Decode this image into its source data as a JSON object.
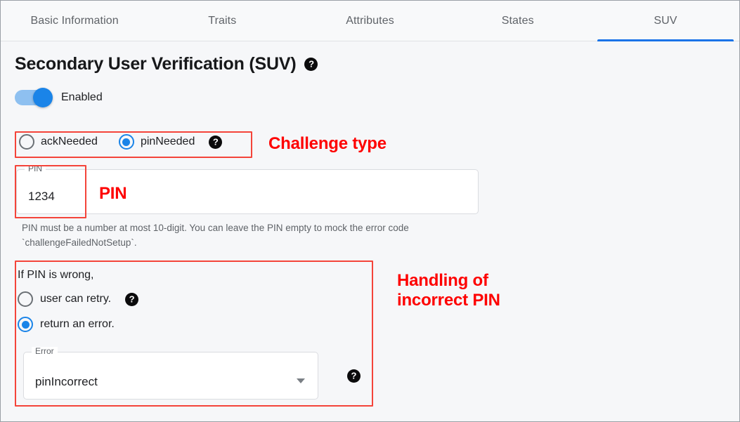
{
  "tabs": [
    {
      "label": "Basic Information",
      "active": false
    },
    {
      "label": "Traits",
      "active": false
    },
    {
      "label": "Attributes",
      "active": false
    },
    {
      "label": "States",
      "active": false
    },
    {
      "label": "SUV",
      "active": true
    }
  ],
  "page": {
    "title": "Secondary User Verification (SUV)",
    "help_glyph": "?"
  },
  "enabled_toggle": {
    "label": "Enabled",
    "state": "on"
  },
  "challenge_type": {
    "options": [
      {
        "label": "ackNeeded",
        "selected": false
      },
      {
        "label": "pinNeeded",
        "selected": true
      }
    ],
    "help_glyph": "?"
  },
  "pin_field": {
    "legend": "PIN",
    "value": "1234",
    "helper_text": "PIN must be a number at most 10-digit. You can leave the PIN empty to mock the error code `challengeFailedNotSetup`."
  },
  "wrong_pin": {
    "title": "If PIN is wrong,",
    "options": [
      {
        "label": "user can retry.",
        "selected": false,
        "has_help": true
      },
      {
        "label": "return an error.",
        "selected": true,
        "has_help": false
      }
    ],
    "error_select": {
      "legend": "Error",
      "value": "pinIncorrect",
      "help_glyph": "?"
    }
  },
  "annotations": [
    {
      "text": "Challenge type"
    },
    {
      "text": "PIN"
    },
    {
      "text": "Handling of\nincorrect PIN"
    }
  ],
  "colors": {
    "accent_blue": "#1a73e8",
    "annotation_red": "#fe0000",
    "redbox_border": "#f4443a",
    "page_background": "#f6f7f9"
  }
}
